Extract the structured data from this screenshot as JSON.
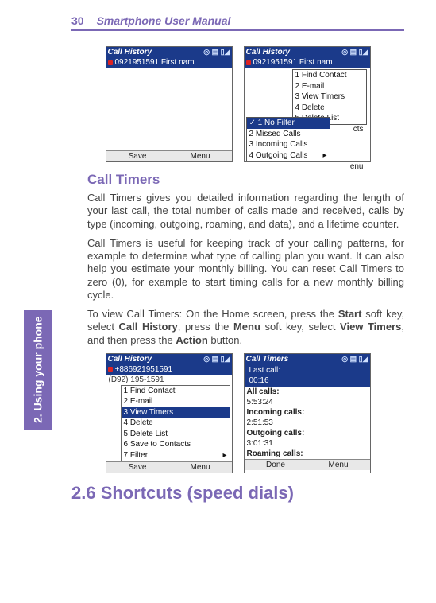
{
  "meta": {
    "page_number": "30",
    "book_title": "Smartphone User Manual",
    "side_tab": "2. Using your phone"
  },
  "screens_top": {
    "left": {
      "title": "Call History",
      "number_row": "0921951591  First nam",
      "soft_left": "Save",
      "soft_right": "Menu"
    },
    "right": {
      "title": "Call History",
      "number_row": "0921951591  First nam",
      "menu1": {
        "i1": "1 Find Contact",
        "i2": "2 E-mail",
        "i3": "3 View Timers",
        "i4": "4 Delete",
        "i5": "5 Delete List"
      },
      "menu2": {
        "i1": "1 No Filter",
        "i2": "2 Missed Calls",
        "i3": "3 Incoming Calls",
        "i4": "4 Outgoing Calls"
      },
      "cts_frag": "cts",
      "enu_frag": "enu"
    }
  },
  "section_call_timers": {
    "heading": "Call Timers",
    "p1": "Call Timers gives you detailed information regarding the length of your last call, the total number of calls made and received, calls by type (incoming, outgoing, roaming, and data), and a lifetime counter.",
    "p2": "Call Timers is useful for keeping track of your calling patterns, for example to determine what type of calling plan you want. It can also help you estimate your monthly billing. You can reset Call Timers to zero (0), for example to start timing calls for a new monthly billing cycle.",
    "p3_a": "To view Call Timers: On the Home screen, press the ",
    "p3_b": "Start",
    "p3_c": " soft key, select ",
    "p3_d": "Call History",
    "p3_e": ", press the ",
    "p3_f": "Menu",
    "p3_g": " soft key, select ",
    "p3_h": "View Timers",
    "p3_i": ", and then press the ",
    "p3_j": "Action",
    "p3_k": " button."
  },
  "screens_bottom": {
    "left": {
      "title": "Call History",
      "row1": "+886921951591",
      "row2": "(D92) 195-1591",
      "m1": "1 Find Contact",
      "m2": "2 E-mail",
      "m3": "3 View Timers",
      "m4": "4 Delete",
      "m5": "5 Delete List",
      "m6": "6 Save to Contacts",
      "m7": "7 Filter",
      "soft_left": "Save",
      "soft_right": "Menu"
    },
    "right": {
      "title": "Call Timers",
      "l1": "Last call:",
      "l2": "00:16",
      "l3": "All calls:",
      "l4": "5:53:24",
      "l5": "Incoming calls:",
      "l6": "2:51:53",
      "l7": "Outgoing calls:",
      "l8": "3:01:31",
      "l9": "Roaming calls:",
      "soft_left": "Done",
      "soft_right": "Menu"
    }
  },
  "section_26": {
    "heading": "2.6  Shortcuts (speed dials)"
  },
  "icons": {
    "status": "◎ ▤ ▯◢"
  }
}
